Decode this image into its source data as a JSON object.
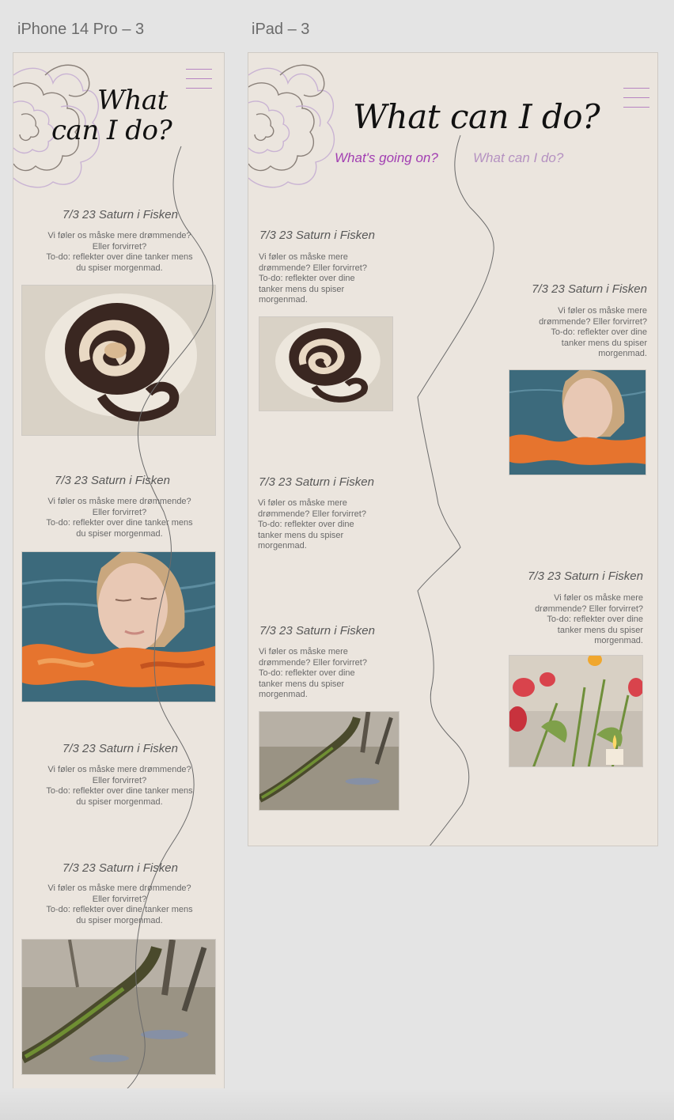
{
  "frames": {
    "iphone": {
      "label": "iPhone 14 Pro – 3"
    },
    "ipad": {
      "label": "iPad – 3"
    }
  },
  "iphone": {
    "title_line1": "What",
    "title_line2": "can I do?",
    "posts": [
      {
        "date": "7/3 23 Saturn i Fisken",
        "body": "Vi føler os måske mere drømmende?\nEller forvirret?\nTo-do: reflekter over dine tanker mens\ndu spiser morgenmad."
      },
      {
        "date": "7/3 23 Saturn i Fisken",
        "body": "Vi føler os måske mere drømmende?\nEller forvirret?\nTo-do: reflekter over dine tanker mens\ndu spiser morgenmad."
      },
      {
        "date": "7/3 23 Saturn i Fisken",
        "body": "Vi føler os måske mere drømmende?\nEller forvirret?\nTo-do: reflekter over dine tanker mens\ndu spiser morgenmad."
      },
      {
        "date": "7/3 23 Saturn i Fisken",
        "body": "Vi føler os måske mere drømmende?\nEller forvirret?\nTo-do: reflekter over dine tanker mens\ndu spiser morgenmad."
      }
    ]
  },
  "ipad": {
    "title": "What can I do?",
    "nav": [
      {
        "label": "What's going on?",
        "color": "#a23fb2"
      },
      {
        "label": "What can I do?",
        "color": "#b592c1"
      }
    ],
    "posts": [
      {
        "date": "7/3 23 Saturn i Fisken",
        "body": "Vi føler os måske mere\ndrømmende? Eller forvirret?\nTo-do: reflekter over dine\ntanker mens du spiser\nmorgenmad."
      },
      {
        "date": "7/3 23 Saturn i Fisken",
        "body": "Vi føler os måske mere\ndrømmende? Eller forvirret?\nTo-do: reflekter over dine\ntanker mens du spiser\nmorgenmad."
      },
      {
        "date": "7/3 23 Saturn i Fisken",
        "body": "Vi føler os måske mere\ndrømmende? Eller forvirret?\nTo-do: reflekter over dine\ntanker mens du spiser\nmorgenmad."
      },
      {
        "date": "7/3 23 Saturn i Fisken",
        "body": "Vi føler os måske mere\ndrømmende? Eller forvirret?\nTo-do: reflekter over dine\ntanker mens du spiser\nmorgenmad."
      },
      {
        "date": "7/3 23 Saturn i Fisken",
        "body": "Vi føler os måske mere\ndrømmende? Eller forvirret?\nTo-do: reflekter over dine\ntanker mens du spiser\nmorgenmad."
      }
    ]
  },
  "colors": {
    "canvas": "#e4e4e4",
    "artboard": "#ebe5de",
    "accent_purple": "#b784c2",
    "title": "#111111"
  }
}
